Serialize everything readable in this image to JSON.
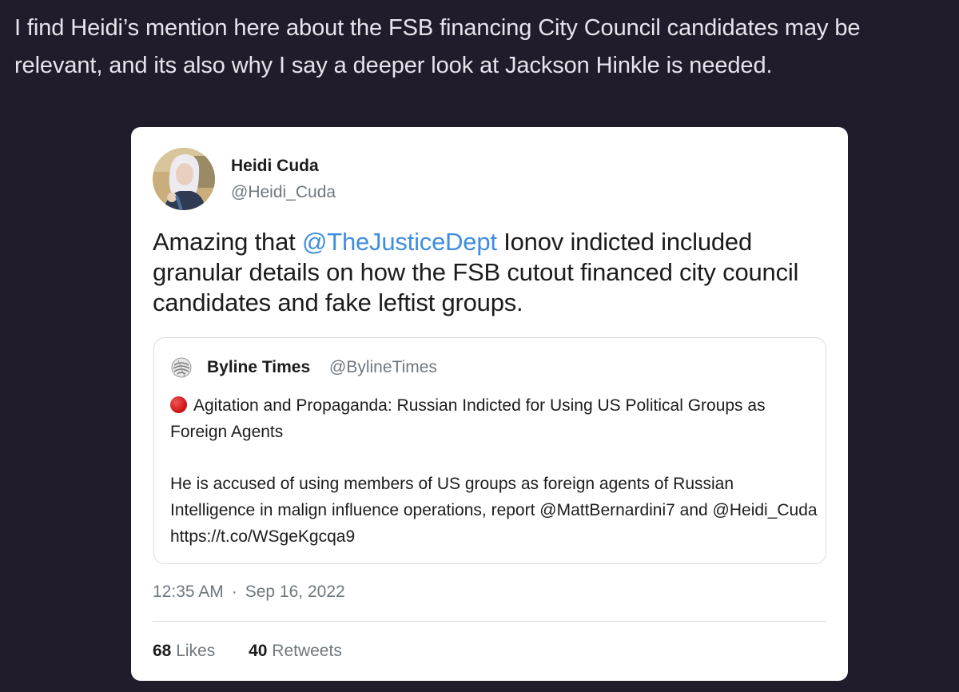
{
  "post": {
    "text": "I find Heidi’s mention here about the FSB financing City Council candidates may be relevant, and its also why I say a deeper look at Jackson Hinkle is needed."
  },
  "tweet": {
    "author": {
      "name": "Heidi Cuda",
      "handle": "@Heidi_Cuda",
      "avatar_icon": "profile-photo"
    },
    "text_before": "Amazing that ",
    "mention": "@TheJusticeDept",
    "text_after": " Ionov indicted included granular details on how the FSB cutout financed city council candidates and fake leftist groups.",
    "mention_color": "#3d8ee0",
    "quote": {
      "icon": "byline-times-logo",
      "name": "Byline Times",
      "handle": "@BylineTimes",
      "bullet_icon": "red-circle",
      "headline": "Agitation and Propaganda: Russian Indicted for Using US Political Groups as Foreign Agents",
      "body": "He is accused of using members of US groups as foreign agents of Russian Intelligence in malign influence operations, report @MattBernardini7 and @Heidi_Cuda https://t.co/WSgeKgcqa9"
    },
    "time": "12:35 AM",
    "separator": "·",
    "date": "Sep 16, 2022",
    "likes_count": "68",
    "likes_label": "Likes",
    "retweets_count": "40",
    "retweets_label": "Retweets"
  },
  "colors": {
    "background": "#201c2c",
    "card": "#ffffff",
    "red_bullet": "#d01919"
  }
}
